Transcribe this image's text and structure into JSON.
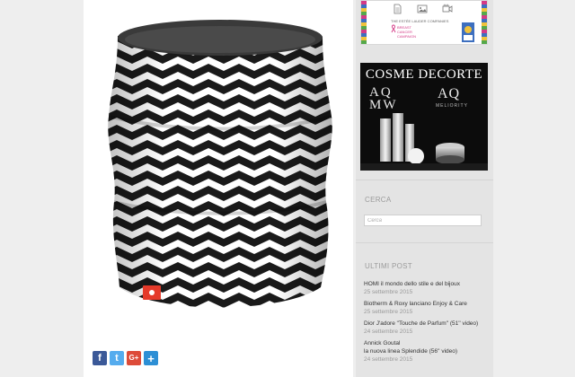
{
  "share": [
    {
      "label": "f",
      "color": "#3b5998"
    },
    {
      "label": "t",
      "color": "#55acee"
    },
    {
      "label": "G+",
      "color": "#dd4b39"
    },
    {
      "label": "+",
      "color": "#2d8fd5"
    }
  ],
  "product": {
    "image": "zigzag-neck-warmer",
    "tag_color": "#e53a2a"
  },
  "sidebar": {
    "ad_top": {
      "icons": [
        "document-icon",
        "image-icon",
        "video-icon"
      ],
      "company": "THE ESTÉE LAUDER COMPANIES",
      "line1": "BREAST",
      "line2": "CANCER",
      "line3": "CAMPAIGN"
    },
    "ad_cosme": {
      "brand": "COSME DECORTE",
      "left_mark_1": "AQ",
      "left_mark_2": "MW",
      "right_mark": "AQ",
      "sub": "MELIORITY"
    },
    "search": {
      "title": "CERCA",
      "placeholder": "Cerca"
    },
    "recent": {
      "title": "ULTIMI POST",
      "posts": [
        {
          "title": "HOMI il mondo dello stile e del bijoux",
          "date": "25 settembre 2015"
        },
        {
          "title": "Biotherm & Roxy lanciano Enjoy & Care",
          "date": "25 settembre 2015"
        },
        {
          "title": "Dior J'adore \"Touche de Parfum\" (51'' video)",
          "date": "24 settembre 2015"
        },
        {
          "title": "Annick Goutal\nla nuova linea Splendide (56'' video)",
          "date": "24 settembre 2015"
        }
      ]
    }
  }
}
